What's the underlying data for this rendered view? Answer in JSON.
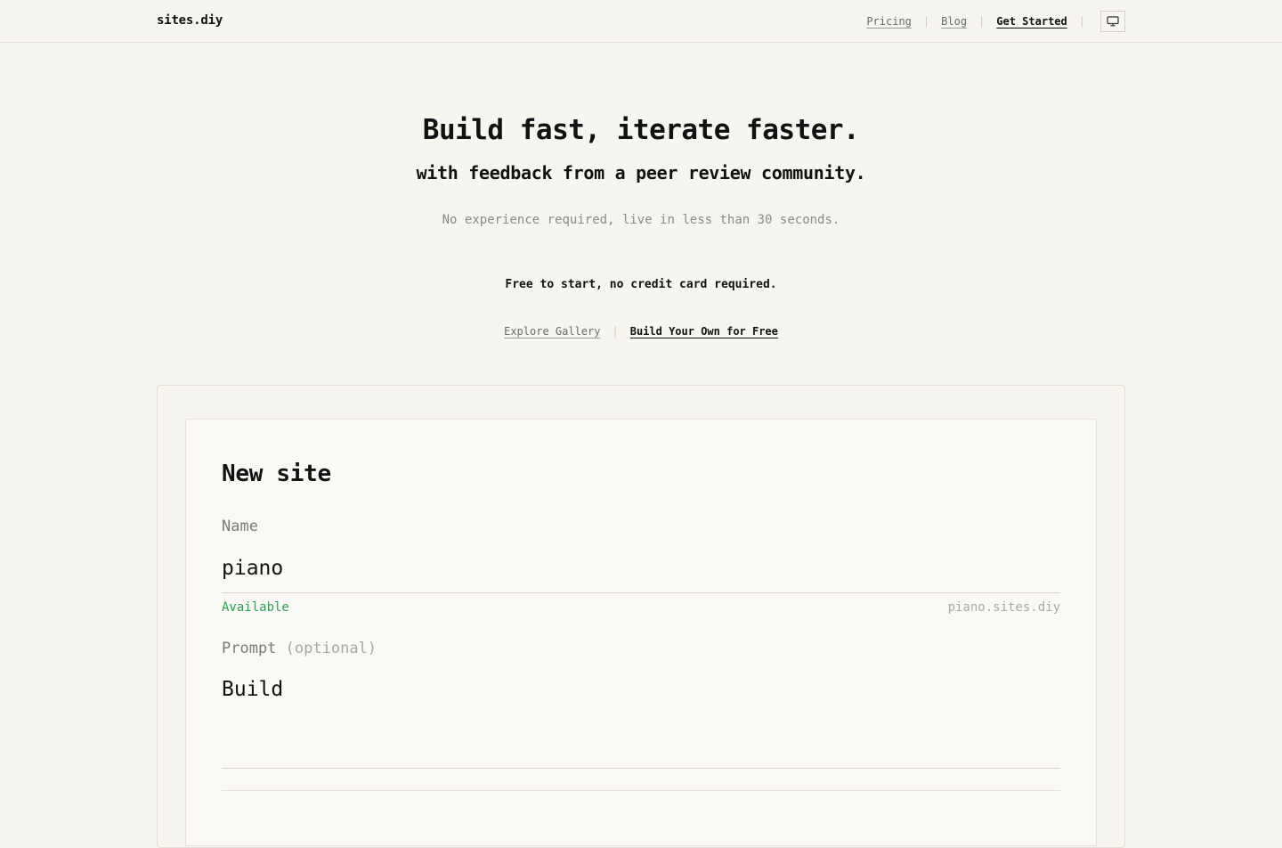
{
  "header": {
    "logo": "sites.diy",
    "nav": {
      "pricing": "Pricing",
      "blog": "Blog",
      "get_started": "Get Started",
      "separator": "|"
    },
    "theme_icon": "monitor-icon"
  },
  "hero": {
    "title": "Build fast, iterate faster.",
    "subtitle": "with feedback from a peer review community.",
    "description": "No experience required, live in less than 30 seconds.",
    "free_note": "Free to start, no credit card required.",
    "cta": {
      "explore": "Explore Gallery",
      "separator": "|",
      "build": "Build Your Own for Free"
    }
  },
  "form": {
    "title": "New site",
    "name_label": "Name",
    "name_value": "piano",
    "status": "Available",
    "domain": "piano.sites.diy",
    "prompt_label": "Prompt",
    "prompt_optional": "(optional)",
    "prompt_value": "Build"
  },
  "colors": {
    "background": "#f7f5ef",
    "card": "#faf9f6",
    "available": "#2aa052",
    "muted": "#8a8a8a"
  }
}
